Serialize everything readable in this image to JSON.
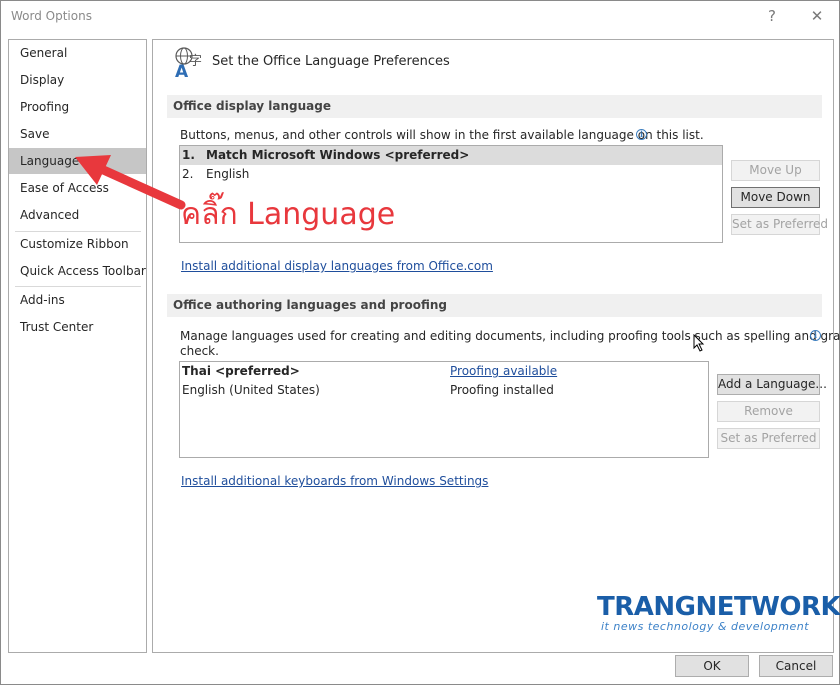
{
  "window": {
    "title": "Word Options",
    "help_glyph": "?",
    "close_glyph": "✕"
  },
  "sidebar": {
    "items": [
      {
        "label": "General"
      },
      {
        "label": "Display"
      },
      {
        "label": "Proofing"
      },
      {
        "label": "Save"
      },
      {
        "label": "Language"
      },
      {
        "label": "Ease of Access"
      },
      {
        "label": "Advanced"
      },
      {
        "label": "Customize Ribbon"
      },
      {
        "label": "Quick Access Toolbar"
      },
      {
        "label": "Add-ins"
      },
      {
        "label": "Trust Center"
      }
    ],
    "selected": "Language"
  },
  "main": {
    "title": "Set the Office Language Preferences",
    "display_section": {
      "header": "Office display language",
      "description": "Buttons, menus, and other controls will show in the first available language on this list.",
      "info_glyph": "i",
      "list": [
        {
          "index": "1.",
          "label": "Match Microsoft Windows <preferred>"
        },
        {
          "index": "2.",
          "label": "English"
        }
      ],
      "buttons": {
        "move_up": "Move Up",
        "move_down": "Move Down",
        "set_preferred": "Set as Preferred"
      },
      "link": "Install additional display languages from Office.com"
    },
    "authoring_section": {
      "header": "Office authoring languages and proofing",
      "description_line1": "Manage languages used for creating and editing documents, including proofing tools such as spelling and grammar",
      "description_line2": "check.",
      "info_glyph": "i",
      "list": [
        {
          "language": "Thai <preferred>",
          "status": "Proofing available"
        },
        {
          "language": "English (United States)",
          "status": "Proofing installed"
        }
      ],
      "buttons": {
        "add_language": "Add a Language...",
        "remove": "Remove",
        "set_preferred": "Set as Preferred"
      },
      "link": "Install additional keyboards from Windows Settings"
    }
  },
  "footer": {
    "ok": "OK",
    "cancel": "Cancel"
  },
  "annotation": {
    "text": "คลิ๊ก Language",
    "color": "#e8383d"
  },
  "watermark": {
    "brand": "TRANGNETWORK",
    "tagline": "it news technology & development"
  }
}
